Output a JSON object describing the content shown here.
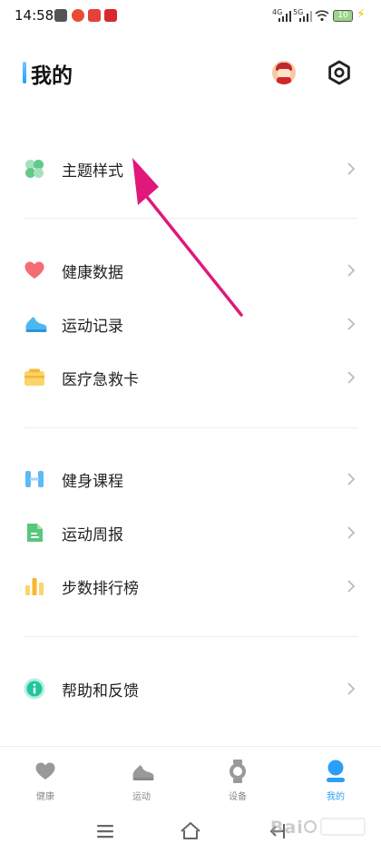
{
  "status_bar": {
    "time": "14:58",
    "network_1": "4G",
    "network_2": "5G",
    "battery": "10"
  },
  "header": {
    "title": "我的"
  },
  "menu": {
    "items": [
      {
        "label": "主题样式",
        "icon": "theme-icon"
      },
      {
        "label": "健康数据",
        "icon": "heart-icon"
      },
      {
        "label": "运动记录",
        "icon": "sneaker-icon"
      },
      {
        "label": "医疗急救卡",
        "icon": "medical-card-icon"
      },
      {
        "label": "健身课程",
        "icon": "dumbbell-icon"
      },
      {
        "label": "运动周报",
        "icon": "document-icon"
      },
      {
        "label": "步数排行榜",
        "icon": "bar-chart-icon"
      },
      {
        "label": "帮助和反馈",
        "icon": "info-icon"
      }
    ]
  },
  "bottom_nav": {
    "items": [
      {
        "label": "健康",
        "icon": "heart-icon"
      },
      {
        "label": "运动",
        "icon": "shoe-icon"
      },
      {
        "label": "设备",
        "icon": "watch-icon"
      },
      {
        "label": "我的",
        "icon": "person-icon"
      }
    ],
    "active": "我的"
  },
  "colors": {
    "accent": "#2b9ff7",
    "annotation_arrow": "#e0187a"
  }
}
